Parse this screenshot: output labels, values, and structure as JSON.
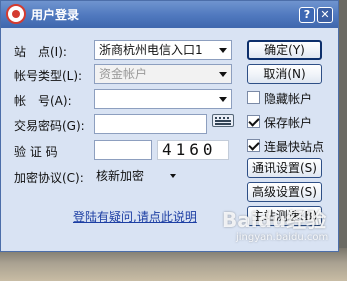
{
  "window": {
    "title": "用户登录"
  },
  "titlebar": {
    "help_symbol": "?",
    "close_symbol": "✕"
  },
  "form": {
    "site": {
      "label": "站　点(I):",
      "value": "浙商杭州电信入口1"
    },
    "account_type": {
      "label": "帐号类型(L):",
      "value": "资金帐户"
    },
    "account": {
      "label": "帐　号(A):",
      "value": ""
    },
    "trade_password": {
      "label": "交易密码(G):",
      "value": ""
    },
    "captcha": {
      "label": "验 证 码",
      "input_value": "",
      "code": "4160"
    },
    "encryption": {
      "label": "加密协议(C):",
      "value": "核新加密"
    }
  },
  "buttons": {
    "confirm": "确定(Y)",
    "cancel": "取消(N)",
    "comm_settings": "通讯设置(S)",
    "advanced_settings": "高级设置(S)",
    "speed_test": "主站测速(B)"
  },
  "checkboxes": {
    "hide_account": {
      "label": "隐藏帐户",
      "checked": false
    },
    "save_account": {
      "label": "保存帐户",
      "checked": true
    },
    "fastest_site": {
      "label": "连最快站点",
      "checked": true
    }
  },
  "help_link": "登陆有疑问,请点此说明",
  "watermark": {
    "main": "Baidu经验",
    "sub": "jingyan.baidu.com"
  },
  "colors": {
    "titlebar": "#4f78be",
    "dialog_bg": "#d9e3f3",
    "link": "#1c3ea3",
    "logo": "#d43b30"
  },
  "icons": {
    "logo": "app-logo-icon",
    "keyboard": "soft-keyboard-icon"
  }
}
